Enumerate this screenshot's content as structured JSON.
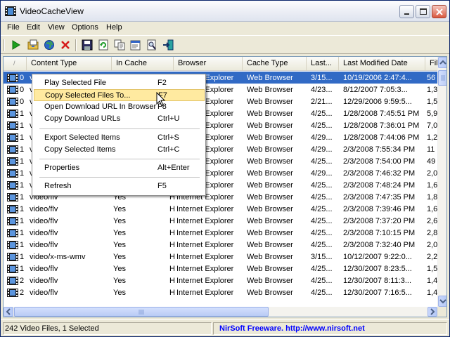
{
  "window": {
    "title": "VideoCacheView"
  },
  "menu": [
    "File",
    "Edit",
    "View",
    "Options",
    "Help"
  ],
  "toolbar": {
    "buttons": [
      "play-icon",
      "copy-files-icon",
      "open-url-icon",
      "delete-icon",
      "save-icon",
      "refresh-icon",
      "copy-icon",
      "properties-icon",
      "find-icon",
      "exit-icon"
    ]
  },
  "columns": [
    "/",
    "Content Type",
    "In Cache",
    "Browser",
    "Cache Type",
    "Last...",
    "Last Modified Date",
    "Fil"
  ],
  "rows": [
    {
      "n": "0",
      "content": "video/x-ms-wmv",
      "incache": "Yes",
      "h": "H",
      "browser": "Internet Explorer",
      "cachetype": "Web Browser",
      "last": "3/15...",
      "modified": "10/19/2006 2:47:4...",
      "fil": "56"
    },
    {
      "n": "0",
      "content": "video/flv",
      "incache": "Yes",
      "h": "H",
      "browser": "Internet Explorer",
      "cachetype": "Web Browser",
      "last": "4/23...",
      "modified": "8/12/2007 7:05:3...",
      "fil": "1,3"
    },
    {
      "n": "0",
      "content": "video/flv",
      "incache": "Yes",
      "h": "H",
      "browser": "Internet Explorer",
      "cachetype": "Web Browser",
      "last": "2/21...",
      "modified": "12/29/2006 9:59:5...",
      "fil": "1,5"
    },
    {
      "n": "1",
      "content": "video/flv",
      "incache": "Yes",
      "h": "H",
      "browser": "Internet Explorer",
      "cachetype": "Web Browser",
      "last": "4/25...",
      "modified": "1/28/2008 7:45:51 PM",
      "fil": "5,9"
    },
    {
      "n": "1",
      "content": "video/flv",
      "incache": "Yes",
      "h": "H",
      "browser": "Internet Explorer",
      "cachetype": "Web Browser",
      "last": "4/25...",
      "modified": "1/28/2008 7:36:01 PM",
      "fil": "7,0"
    },
    {
      "n": "1",
      "content": "video/flv",
      "incache": "Yes",
      "h": "H",
      "browser": "Internet Explorer",
      "cachetype": "Web Browser",
      "last": "4/29...",
      "modified": "1/28/2008 7:44:06 PM",
      "fil": "1,2"
    },
    {
      "n": "1",
      "content": "video/flv",
      "incache": "Yes",
      "h": "H",
      "browser": "Internet Explorer",
      "cachetype": "Web Browser",
      "last": "4/29...",
      "modified": "2/3/2008 7:55:34 PM",
      "fil": "11"
    },
    {
      "n": "1",
      "content": "video/flv",
      "incache": "Yes",
      "h": "H",
      "browser": "Internet Explorer",
      "cachetype": "Web Browser",
      "last": "4/25...",
      "modified": "2/3/2008 7:54:00 PM",
      "fil": "49"
    },
    {
      "n": "1",
      "content": "video/flv",
      "incache": "Yes",
      "h": "H",
      "browser": "Internet Explorer",
      "cachetype": "Web Browser",
      "last": "4/29...",
      "modified": "2/3/2008 7:46:32 PM",
      "fil": "2,0"
    },
    {
      "n": "1",
      "content": "video/flv",
      "incache": "Yes",
      "h": "H",
      "browser": "Internet Explorer",
      "cachetype": "Web Browser",
      "last": "4/25...",
      "modified": "2/3/2008 7:48:24 PM",
      "fil": "1,6"
    },
    {
      "n": "1",
      "content": "video/flv",
      "incache": "Yes",
      "h": "H",
      "browser": "Internet Explorer",
      "cachetype": "Web Browser",
      "last": "4/25...",
      "modified": "2/3/2008 7:47:35 PM",
      "fil": "1,8"
    },
    {
      "n": "1",
      "content": "video/flv",
      "incache": "Yes",
      "h": "H",
      "browser": "Internet Explorer",
      "cachetype": "Web Browser",
      "last": "4/25...",
      "modified": "2/3/2008 7:39:46 PM",
      "fil": "1,6"
    },
    {
      "n": "1",
      "content": "video/flv",
      "incache": "Yes",
      "h": "H",
      "browser": "Internet Explorer",
      "cachetype": "Web Browser",
      "last": "4/25...",
      "modified": "2/3/2008 7:37:20 PM",
      "fil": "2,6"
    },
    {
      "n": "1",
      "content": "video/flv",
      "incache": "Yes",
      "h": "H",
      "browser": "Internet Explorer",
      "cachetype": "Web Browser",
      "last": "4/25...",
      "modified": "2/3/2008 7:10:15 PM",
      "fil": "2,8"
    },
    {
      "n": "1",
      "content": "video/flv",
      "incache": "Yes",
      "h": "H",
      "browser": "Internet Explorer",
      "cachetype": "Web Browser",
      "last": "4/25...",
      "modified": "2/3/2008 7:32:40 PM",
      "fil": "2,0"
    },
    {
      "n": "1",
      "content": "video/x-ms-wmv",
      "incache": "Yes",
      "h": "H",
      "browser": "Internet Explorer",
      "cachetype": "Web Browser",
      "last": "3/15...",
      "modified": "10/12/2007 9:22:0...",
      "fil": "2,2"
    },
    {
      "n": "1",
      "content": "video/flv",
      "incache": "Yes",
      "h": "H",
      "browser": "Internet Explorer",
      "cachetype": "Web Browser",
      "last": "4/25...",
      "modified": "12/30/2007 8:23:5...",
      "fil": "1,5"
    },
    {
      "n": "2",
      "content": "video/flv",
      "incache": "Yes",
      "h": "H",
      "browser": "Internet Explorer",
      "cachetype": "Web Browser",
      "last": "4/25...",
      "modified": "12/30/2007 8:11:3...",
      "fil": "1,4"
    },
    {
      "n": "2",
      "content": "video/flv",
      "incache": "Yes",
      "h": "H",
      "browser": "Internet Explorer",
      "cachetype": "Web Browser",
      "last": "4/25...",
      "modified": "12/30/2007 7:16:5...",
      "fil": "1,4"
    }
  ],
  "selected_row": 0,
  "context_menu": {
    "items": [
      {
        "label": "Play Selected File",
        "key": "F2"
      },
      {
        "label": "Copy Selected Files To...",
        "key": "F7"
      },
      {
        "label": "Open Download URL In Browser",
        "key": "F8"
      },
      {
        "label": "Copy Download URLs",
        "key": "Ctrl+U"
      },
      {
        "label": "Export Selected Items",
        "key": "Ctrl+S"
      },
      {
        "label": "Copy Selected Items",
        "key": "Ctrl+C"
      },
      {
        "label": "Properties",
        "key": "Alt+Enter"
      },
      {
        "label": "Refresh",
        "key": "F5"
      }
    ],
    "highlighted": 1
  },
  "status": {
    "count": "242 Video Files, 1 Selected",
    "credit": "NirSoft Freeware.  http://www.nirsoft.net"
  },
  "colors": {
    "selection": "#316ac5",
    "menu_highlight": "#ffeaa0",
    "link": "#0000ff"
  }
}
